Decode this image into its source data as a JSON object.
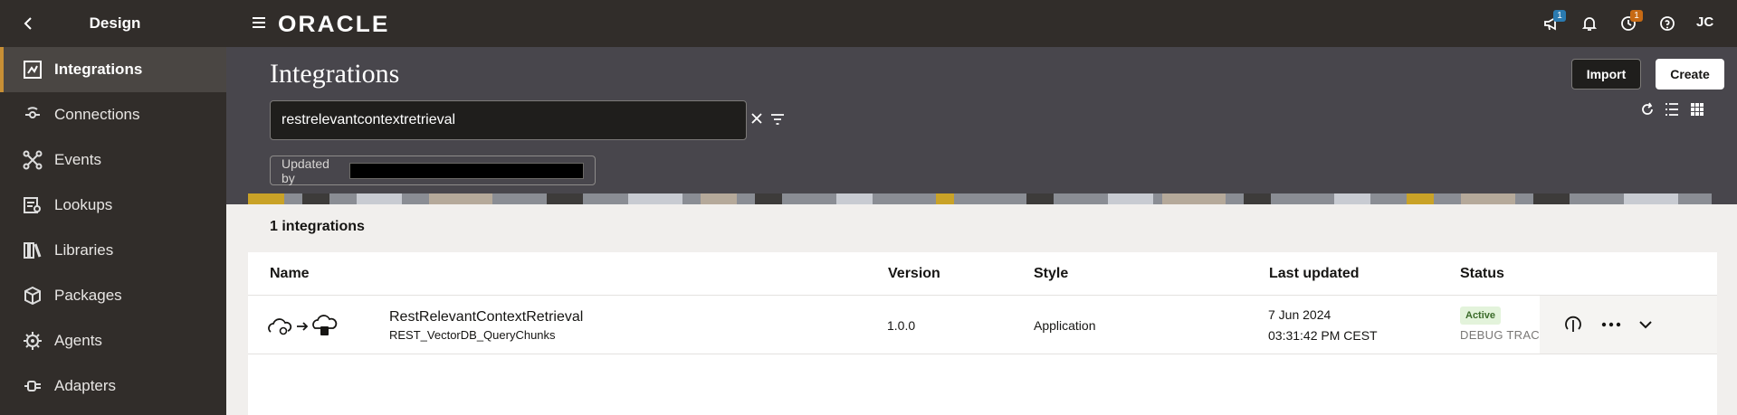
{
  "sidebar": {
    "title": "Design",
    "items": [
      {
        "label": "Integrations",
        "icon": "integrations-icon",
        "active": true
      },
      {
        "label": "Connections",
        "icon": "connections-icon"
      },
      {
        "label": "Events",
        "icon": "events-icon"
      },
      {
        "label": "Lookups",
        "icon": "lookups-icon"
      },
      {
        "label": "Libraries",
        "icon": "libraries-icon"
      },
      {
        "label": "Packages",
        "icon": "packages-icon"
      },
      {
        "label": "Agents",
        "icon": "agents-icon"
      },
      {
        "label": "Adapters",
        "icon": "adapters-icon"
      }
    ]
  },
  "topbar": {
    "logo": "ORACLE",
    "announcements_badge": "1",
    "activity_badge": "1",
    "user_initials": "JC"
  },
  "header": {
    "title": "Integrations",
    "search_value": "restrelevantcontextretrieval",
    "filter_chip_label": "Updated by",
    "import_label": "Import",
    "create_label": "Create"
  },
  "results": {
    "count_text": "1 integrations"
  },
  "table": {
    "columns": [
      "Name",
      "Version",
      "Style",
      "Last updated",
      "Status"
    ],
    "rows": [
      {
        "name": "RestRelevantContextRetrieval",
        "identifier": "REST_VectorDB_QueryChunks",
        "version": "1.0.0",
        "style": "Application",
        "date": "7 Jun 2024",
        "time": "03:31:42 PM CEST",
        "status": "Active",
        "status_sub": "DEBUG TRACIN"
      }
    ]
  },
  "colors": {
    "sidebar_bg": "#312d2a",
    "header_bg": "#48464c",
    "accent": "#c78f35",
    "badge_blue": "#2a7ab0",
    "badge_orange": "#c76a14",
    "active_green": "#e3f3db"
  }
}
